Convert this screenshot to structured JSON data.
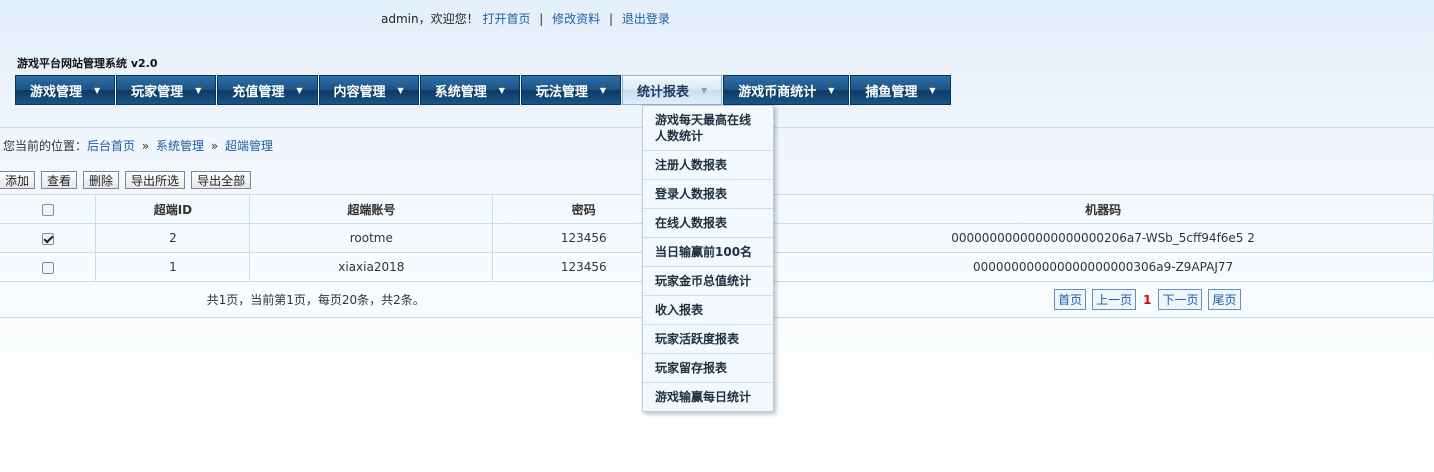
{
  "header": {
    "user": "admin",
    "welcome": "，欢迎您！",
    "links": [
      "打开首页",
      "修改资料",
      "退出登录"
    ],
    "separator": "|"
  },
  "site_title": "游戏平台网站管理系统 v2.0",
  "nav": {
    "items": [
      {
        "label": "游戏管理"
      },
      {
        "label": "玩家管理"
      },
      {
        "label": "充值管理"
      },
      {
        "label": "内容管理"
      },
      {
        "label": "系统管理"
      },
      {
        "label": "玩法管理"
      },
      {
        "label": "统计报表",
        "active": true
      },
      {
        "label": "游戏币商统计"
      },
      {
        "label": "捕鱼管理"
      }
    ]
  },
  "dropdown": {
    "items": [
      "游戏每天最高在线人数统计",
      "注册人数报表",
      "登录人数报表",
      "在线人数报表",
      "当日输赢前100名",
      "玩家金币总值统计",
      "收入报表",
      "玩家活跃度报表",
      "玩家留存报表",
      "游戏输赢每日统计"
    ]
  },
  "breadcrumb": {
    "prefix": "您当前的位置：",
    "items": [
      "后台首页",
      "系统管理",
      "超端管理"
    ],
    "separator": "»"
  },
  "toolbar": {
    "buttons": [
      "添加",
      "查看",
      "删除",
      "导出所选",
      "导出全部"
    ]
  },
  "table": {
    "columns": [
      "",
      "超端ID",
      "超端账号",
      "密码",
      "",
      "机器码"
    ],
    "rows": [
      {
        "checked": true,
        "id": "2",
        "account": "rootme",
        "password": "123456",
        "machine": "00000000000000000000206a7-WSb_5cff94f6e5 2"
      },
      {
        "checked": false,
        "id": "1",
        "account": "xiaxia2018",
        "password": "123456",
        "machine": "000000000000000000000306a9-Z9APAJ77"
      }
    ],
    "summary": "共1页，当前第1页，每页20条，共2条。"
  },
  "pager": {
    "first": "首页",
    "prev": "上一页",
    "current": "1",
    "next": "下一页",
    "last": "尾页"
  }
}
